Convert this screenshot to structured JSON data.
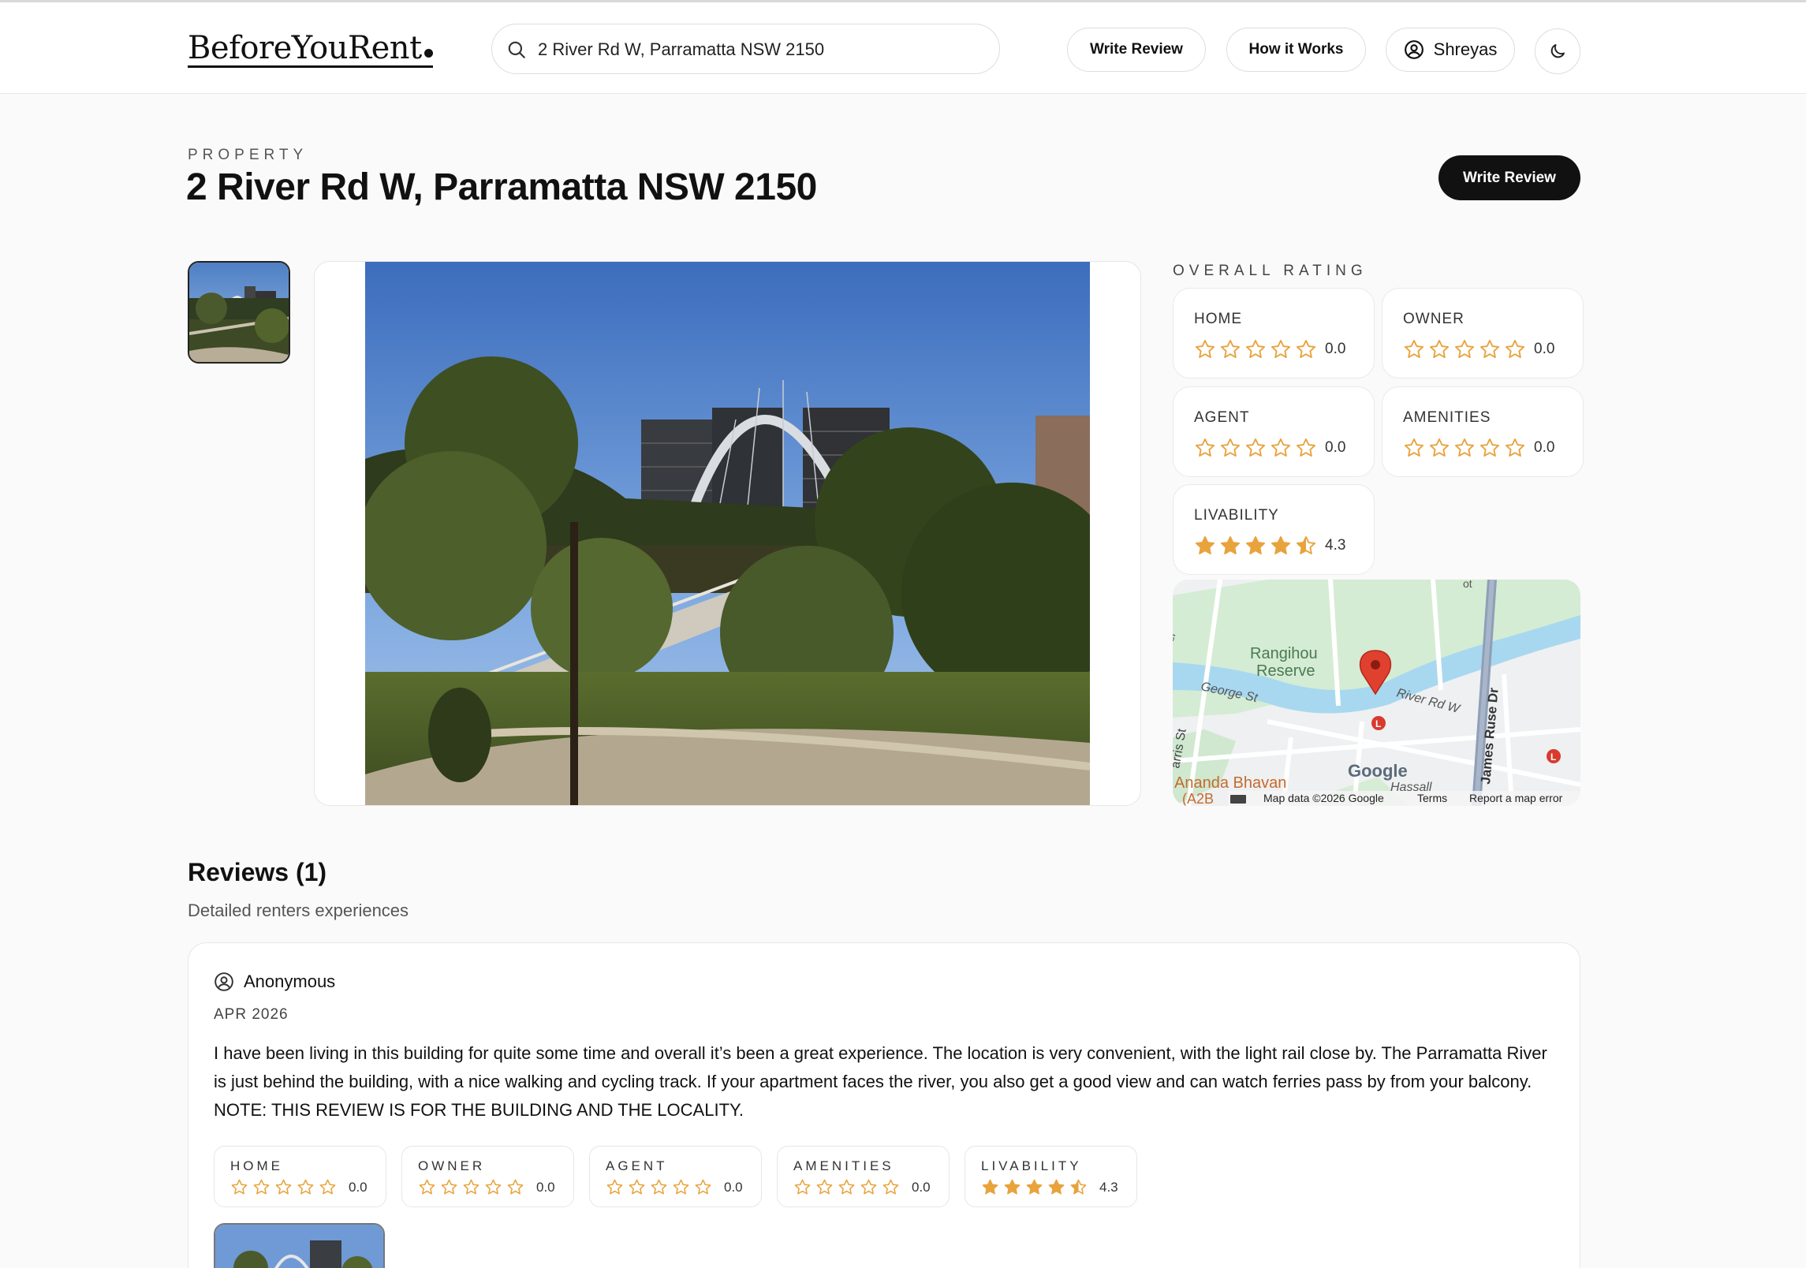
{
  "header": {
    "logo": "BeforeYouRent",
    "search_value": "2 River Rd W, Parramatta NSW 2150",
    "write_review": "Write Review",
    "how_it_works": "How it Works",
    "user_name": "Shreyas"
  },
  "property": {
    "eyebrow": "PROPERTY",
    "address": "2 River Rd W, Parramatta NSW 2150",
    "write_review": "Write Review"
  },
  "ratings": {
    "label": "OVERALL RATING",
    "items": [
      {
        "label": "HOME",
        "value": "0.0",
        "score": 0
      },
      {
        "label": "OWNER",
        "value": "0.0",
        "score": 0
      },
      {
        "label": "AGENT",
        "value": "0.0",
        "score": 0
      },
      {
        "label": "AMENITIES",
        "value": "0.0",
        "score": 0
      },
      {
        "label": "LIVABILITY",
        "value": "4.3",
        "score": 4.3
      }
    ]
  },
  "map": {
    "labels": {
      "reserve_1": "Rangihou",
      "reserve_2": "Reserve",
      "george_st": "George St",
      "river_rd": "River Rd W",
      "james_ruse": "James Ruse Dr",
      "harris_st": "arris St",
      "ananda": "Ananda Bhavan",
      "a2b": "(A2B",
      "hassall": "Hassall",
      "st_label": "St",
      "ot_label": "ot",
      "er_label": "er",
      "pin_l1": "L",
      "pin_l2": "L"
    },
    "google": "Google",
    "attribution": "Map data ©2026 Google",
    "terms": "Terms",
    "report": "Report a map error"
  },
  "reviews": {
    "title": "Reviews (1)",
    "subtitle": "Detailed renters experiences",
    "items": [
      {
        "author": "Anonymous",
        "date": "APR 2026",
        "text": "I have been living in this building for quite some time and overall it’s been a great experience. The location is very convenient, with the light rail close by. The Parramatta River is just behind the building, with a nice walking and cycling track. If your apartment faces the river, you also get a good view and can watch ferries pass by from your balcony. NOTE: THIS REVIEW IS FOR THE BUILDING AND THE LOCALITY.",
        "ratings": [
          {
            "label": "HOME",
            "value": "0.0",
            "score": 0
          },
          {
            "label": "OWNER",
            "value": "0.0",
            "score": 0
          },
          {
            "label": "AGENT",
            "value": "0.0",
            "score": 0
          },
          {
            "label": "AMENITIES",
            "value": "0.0",
            "score": 0
          },
          {
            "label": "LIVABILITY",
            "value": "4.3",
            "score": 4.3
          }
        ]
      }
    ]
  },
  "colors": {
    "star": "#e8a33c",
    "accent": "#111111"
  }
}
